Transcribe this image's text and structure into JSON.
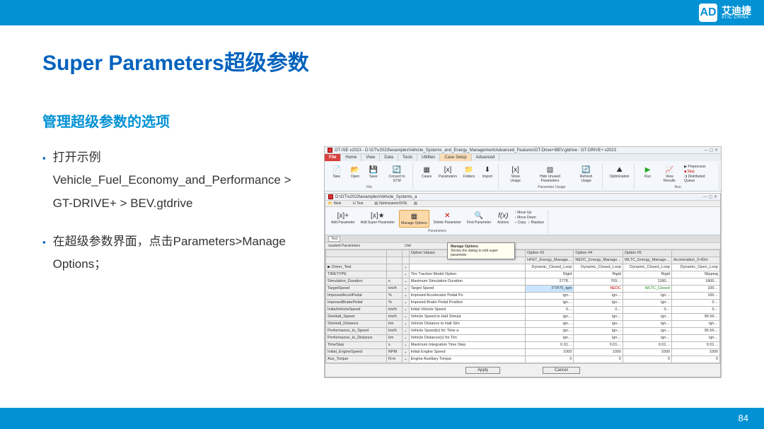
{
  "brand": {
    "cn": "艾迪捷",
    "en": "ATIC CHINA",
    "mark": "AD"
  },
  "title": "Super Parameters超级参数",
  "subtitle": "管理超级参数的选项",
  "bullets": [
    "打开示例 Vehicle_Fuel_Economy_and_Performance > GT-DRIVE+ > BEV.gtdrive",
    "在超级参数界面，点击Parameters>Manage Options；"
  ],
  "page_num": "84",
  "win": {
    "title": "GT-ISE v2023 - D:\\GT\\v2023\\examples\\Vehicle_Systems_and_Energy_Management\\Advanced_Features\\GT-Drive+\\BEV.gtdrive : GT-DRIVE+ v2023",
    "tabs": [
      "File",
      "Home",
      "View",
      "Data",
      "Tools",
      "Utilities",
      "Case Setup",
      "Advanced"
    ],
    "file_grp": {
      "new": "New",
      "open": "Open",
      "save": "Save",
      "convert": "Convert to GTM",
      "label": "File"
    },
    "param_grp": {
      "cases": "Cases",
      "parameters": "Parameters",
      "folders": "Folders",
      "import": "Import",
      "label": ""
    },
    "usage_grp": {
      "show": "Show Usage",
      "hide": "Hide Unused Parameters",
      "refresh": "Refresh Usage",
      "label": "Parameter Usage"
    },
    "opt": {
      "opt": "Optimization",
      "label": ""
    },
    "run_grp": {
      "run": "Run",
      "view": "View Results",
      "pre": "Preprocess",
      "stop": "Stop",
      "dq": "Distributed Queue",
      "label": "Run"
    }
  },
  "sub": {
    "title": "D:\\GT\\v2023\\examples\\Vehicle_Systems_a",
    "bar": {
      "main": "Main",
      "test": "Test",
      "opt": "Optimization/DOE"
    },
    "btns": {
      "add": "Add Parameter",
      "adds": "Add Super Parameter",
      "manage": "Manage Options",
      "delete": "Delete Parameter",
      "find": "Find Parameter",
      "actions": "Actions",
      "up": "Move Up",
      "down": "Move Down",
      "copy": "Copy",
      "replace": "Replace"
    },
    "grplabel": "Parameters",
    "tabline": {
      "sp": "soadent Parameters",
      "unit": "Unit"
    },
    "tooltip": {
      "t": "Manage Options",
      "b": "Shows the dialog to edit super parameter"
    }
  },
  "opt_cols": [
    "Option Values",
    "Option #3",
    "Option #4",
    "Option #5"
  ],
  "opt_r1": [
    "",
    "HFET_Energy_Manage…",
    "NEDC_Energy_Manage…",
    "WLTC_Energy_Manage…",
    "Acceleration_0-60m"
  ],
  "rows": [
    {
      "n": "Driver_Test",
      "u": "",
      "d": "",
      "v": [
        "Dynamic_Closed_Loop",
        "Dynamic_Closed_Loop",
        "Dynamic_Closed_Loop",
        "Dynamic_Open_Loop"
      ]
    },
    {
      "n": "TIRETYPE",
      "u": "",
      "d": "Tire Traction Model Option",
      "v": [
        "Rigid",
        "Rigid",
        "Rigid",
        "Slipping"
      ]
    },
    {
      "n": "Simulation_Duration",
      "u": "s",
      "d": "Maximum Simulation Duration",
      "v": [
        "2778…",
        "765…",
        "1180…",
        "1800…"
      ]
    },
    {
      "n": "TargetSpeed",
      "u": "km/h",
      "d": "Target Speed",
      "v": [
        "FTP75_kph",
        "NEDC",
        "WLTC_Closed",
        "100…"
      ],
      "hl": true
    },
    {
      "n": "ImposedAccelPedal",
      "u": "%",
      "d": "Imposed Accelerator Pedal Po",
      "v": [
        "ign…",
        "ign…",
        "ign…",
        "100…"
      ]
    },
    {
      "n": "ImposedBrakePedal",
      "u": "%",
      "d": "Imposed Brake Pedal Position",
      "v": [
        "ign…",
        "ign…",
        "ign…",
        "0…"
      ]
    },
    {
      "n": "InitialVehicleSpeed",
      "u": "km/h",
      "d": "Initial Vehicle Speed",
      "v": [
        "0…",
        "0…",
        "0…",
        "0…"
      ]
    },
    {
      "n": "SimHalt_Speed",
      "u": "km/h",
      "d": "Vehicle Speed to Halt Simula",
      "v": [
        "ign…",
        "ign…",
        "ign…",
        "96.56…"
      ]
    },
    {
      "n": "SimHalt_Distance",
      "u": "km",
      "d": "Vehicle Distance to Halt Sim",
      "v": [
        "ign…",
        "ign…",
        "ign…",
        "ign…"
      ]
    },
    {
      "n": "Performance_to_Speed",
      "u": "km/h",
      "d": "Vehicle Speed(s) for Time a",
      "v": [
        "ign…",
        "ign…",
        "ign…",
        "96.56…"
      ]
    },
    {
      "n": "Performance_to_Distance",
      "u": "km",
      "d": "Vehicle Distance(s) for Tim",
      "v": [
        "ign…",
        "ign…",
        "ign…",
        "ign…"
      ]
    },
    {
      "n": "TimeStep",
      "u": "s",
      "d": "Maximum Integration Time Step",
      "v": [
        "0.01…",
        "0.01…",
        "0.01…",
        "0.01…"
      ]
    },
    {
      "n": "Initial_EngineSpeed",
      "u": "RPM",
      "d": "Initial Engine Speed",
      "v": [
        "1000",
        "1000",
        "1000",
        "1000"
      ]
    },
    {
      "n": "Aux_Torque",
      "u": "N-m",
      "d": "Engine Auxiliary Torque",
      "v": [
        "0",
        "0",
        "0",
        "0"
      ]
    }
  ],
  "footer": {
    "apply": "Apply",
    "cancel": "Cancel"
  }
}
